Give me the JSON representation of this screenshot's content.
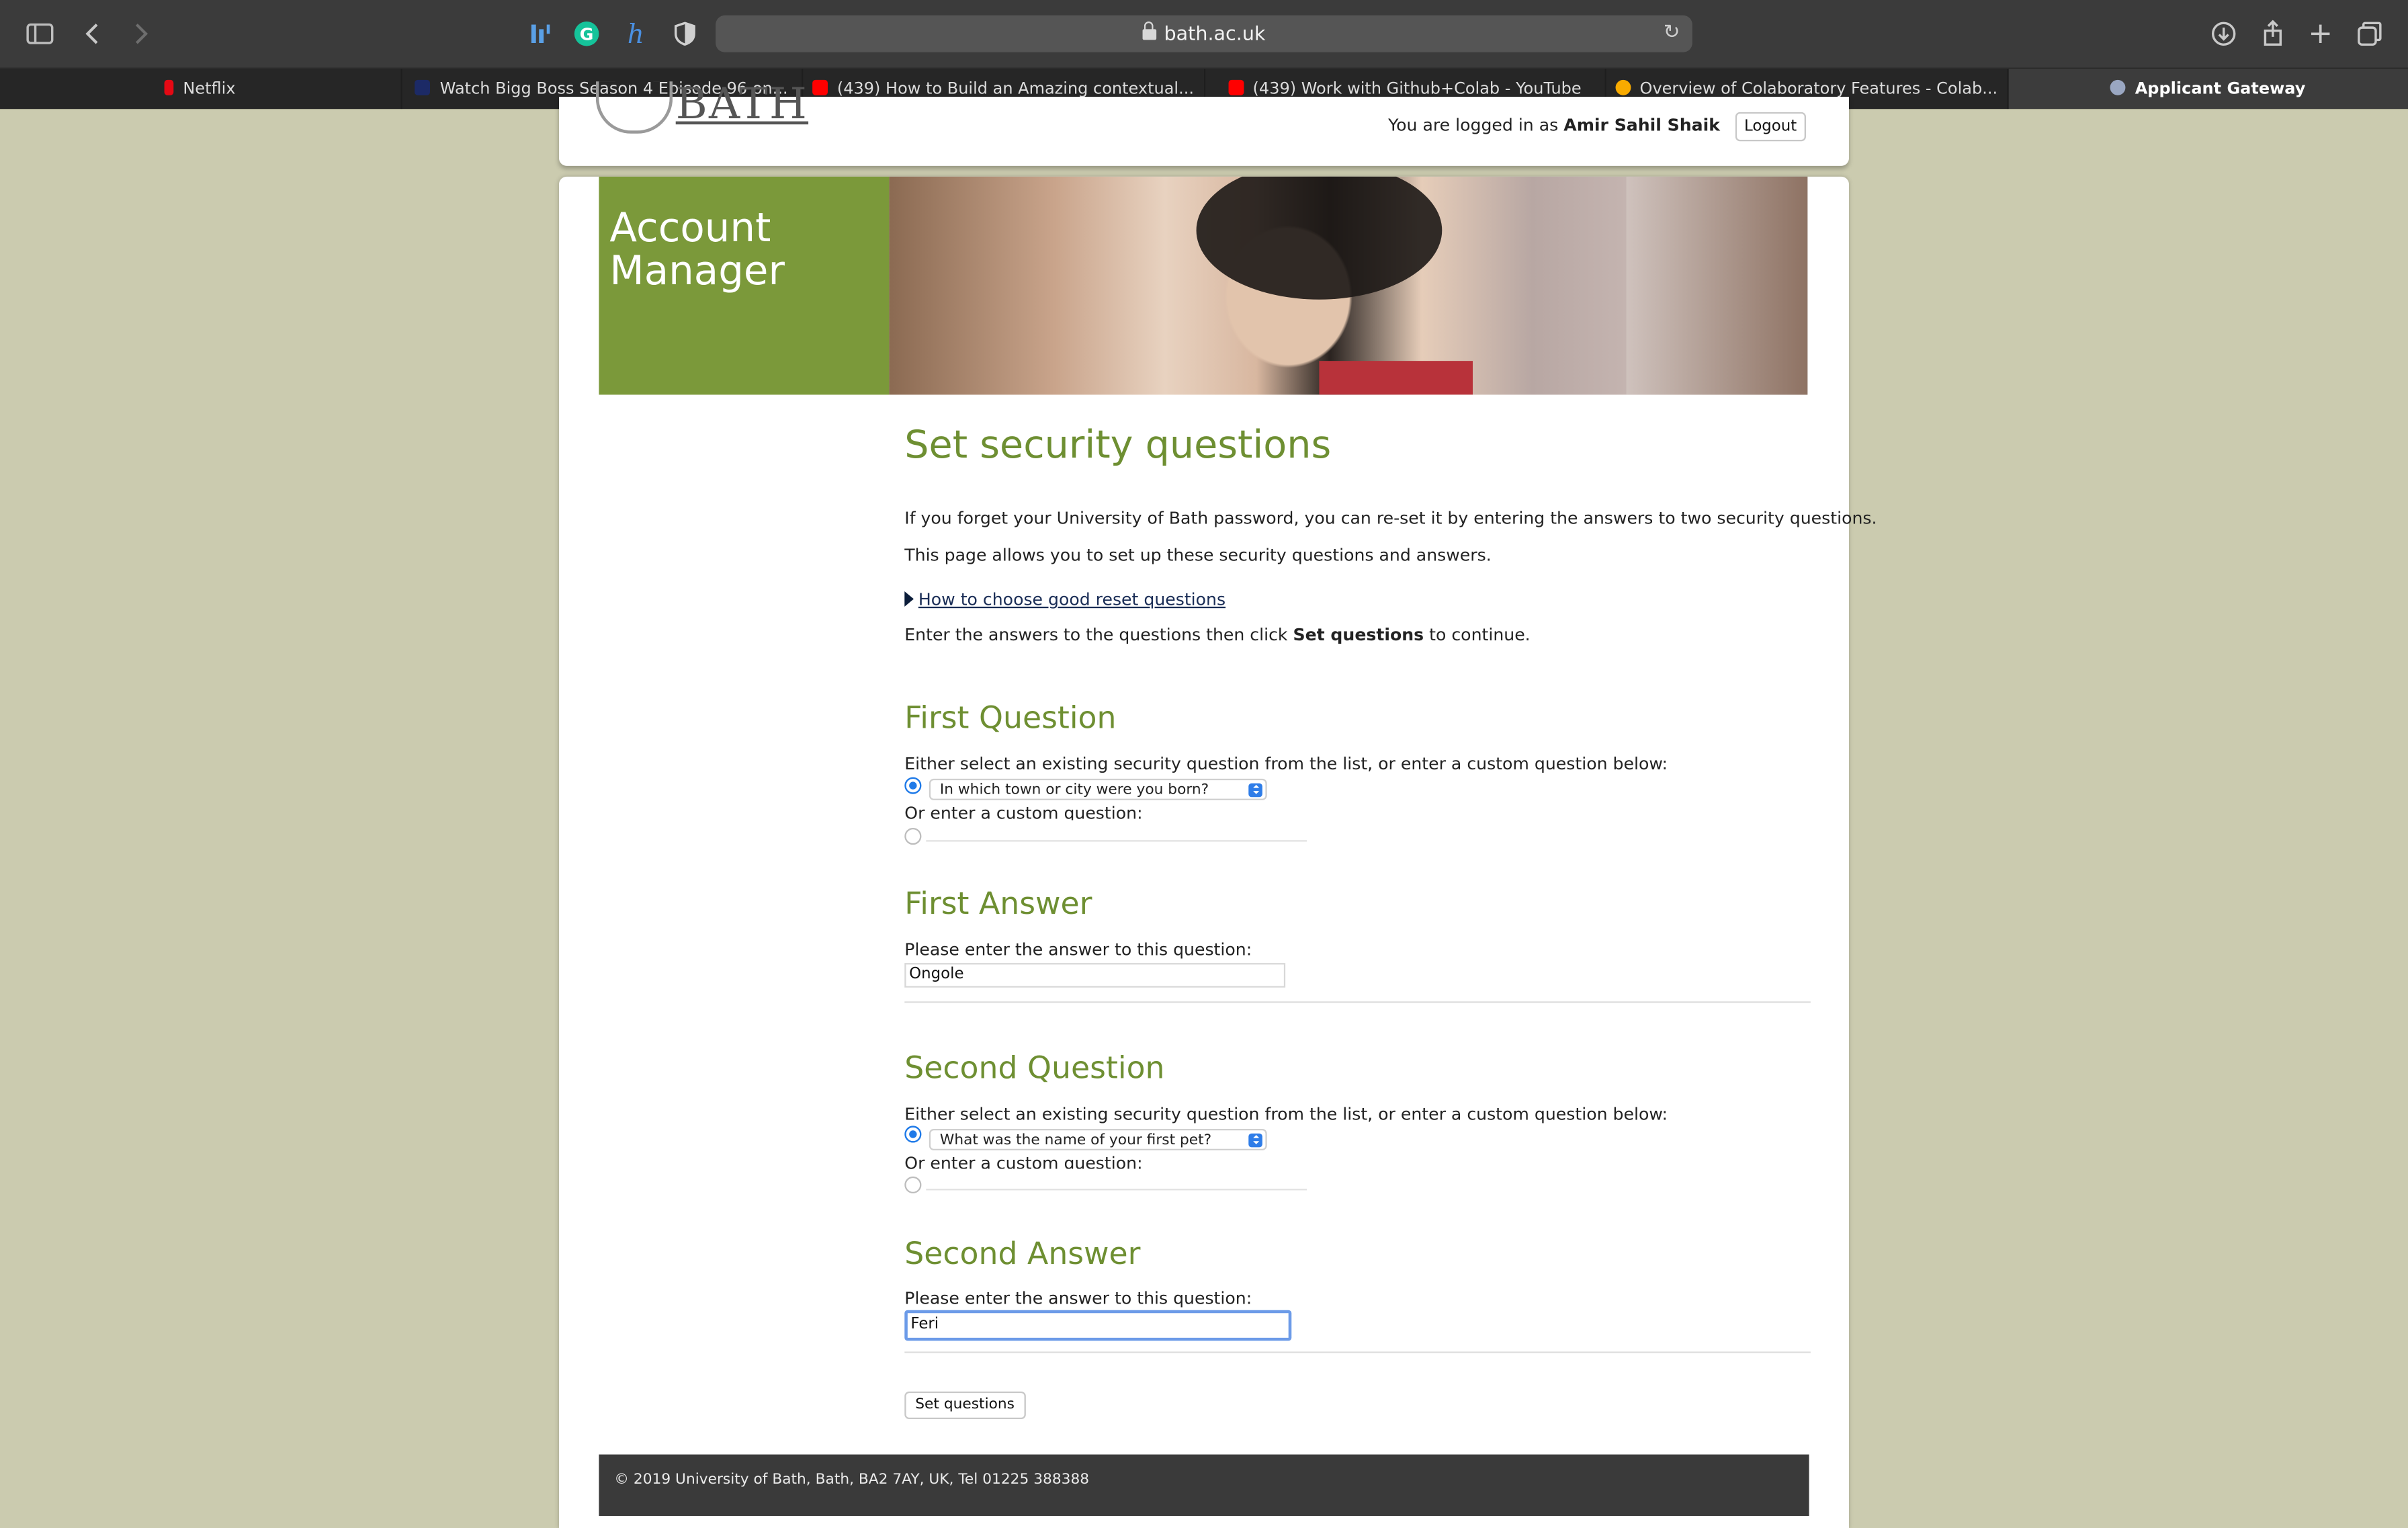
{
  "browser": {
    "url": "bath.ac.uk",
    "tabs": [
      {
        "label": "Netflix",
        "favicon_color": "#e50914"
      },
      {
        "label": "Watch Bigg Boss Season 4 Episode 96 on...",
        "favicon_color": "#1c2a66"
      },
      {
        "label": "(439) How to Build an Amazing contextual...",
        "favicon_color": "#ff0000"
      },
      {
        "label": "(439) Work with Github+Colab - YouTube",
        "favicon_color": "#ff0000"
      },
      {
        "label": "Overview of Colaboratory Features - Colab...",
        "favicon_color": "#f9ab00"
      },
      {
        "label": "Applicant Gateway",
        "favicon_color": "#9aa7c2",
        "active": true
      }
    ]
  },
  "header": {
    "logo_text": "BATH",
    "logged_in_prefix": "You are logged in as",
    "user_name": "Amir Sahil Shaik",
    "logout_label": "Logout"
  },
  "banner": {
    "title": "Account Manager"
  },
  "main": {
    "heading": "Set security questions",
    "intro1": "If you forget your University of Bath password, you can re-set it by entering the answers to two security questions.",
    "intro2": "This page allows you to set up these security questions and answers.",
    "help_link": "How to choose good reset questions",
    "instruction_prefix": "Enter the answers to the questions then click",
    "instruction_bold": "Set questions",
    "instruction_suffix": "to continue.",
    "q1": {
      "heading": "First Question",
      "prompt": "Either select an existing security question from the list, or enter a custom question below:",
      "selected_question": "In which town or city were you born?",
      "custom_label": "Or enter a custom question:",
      "custom_value": ""
    },
    "a1": {
      "heading": "First Answer",
      "prompt": "Please enter the answer to this question:",
      "value": "Ongole"
    },
    "q2": {
      "heading": "Second Question",
      "prompt": "Either select an existing security question from the list, or enter a custom question below:",
      "selected_question": "What was the name of your first pet?",
      "custom_label": "Or enter a custom question:",
      "custom_value": ""
    },
    "a2": {
      "heading": "Second Answer",
      "prompt": "Please enter the answer to this question:",
      "value": "Feri"
    },
    "submit_label": "Set questions"
  },
  "footer": {
    "text": "© 2019 University of Bath, Bath, BA2 7AY, UK, Tel 01225 388388"
  }
}
